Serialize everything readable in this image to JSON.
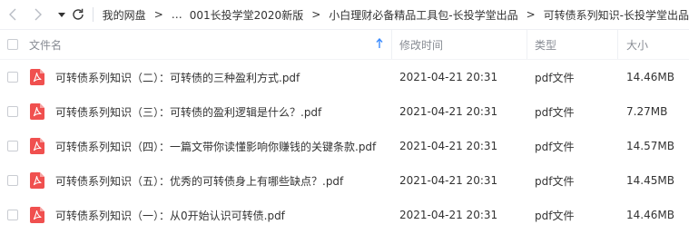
{
  "breadcrumb": {
    "ellipsis": "…",
    "separator": ">",
    "items": [
      "我的网盘",
      "001长投学堂2020新版",
      "小白理财必备精品工具包-长投学堂出品",
      "可转债系列知识-长投学堂出品"
    ]
  },
  "columns": {
    "name": "文件名",
    "modified": "修改时间",
    "type": "类型",
    "size": "大小"
  },
  "files": [
    {
      "name": "可转债系列知识（二）：可转债的三种盈利方式.pdf",
      "modified": "2021-04-21 20:31",
      "type": "pdf文件",
      "size": "14.46MB"
    },
    {
      "name": "可转债系列知识（三）：可转债的盈利逻辑是什么？.pdf",
      "modified": "2021-04-21 20:31",
      "type": "pdf文件",
      "size": "7.27MB"
    },
    {
      "name": "可转债系列知识（四）：一篇文带你读懂影响你赚钱的关键条款.pdf",
      "modified": "2021-04-21 20:31",
      "type": "pdf文件",
      "size": "14.57MB"
    },
    {
      "name": "可转债系列知识（五）：优秀的可转债身上有哪些缺点？.pdf",
      "modified": "2021-04-21 20:31",
      "type": "pdf文件",
      "size": "14.45MB"
    },
    {
      "name": "可转债系列知识（一）：从0开始认识可转债.pdf",
      "modified": "2021-04-21 20:31",
      "type": "pdf文件",
      "size": "14.46MB"
    }
  ],
  "icons": {
    "back": "chevron-left-icon",
    "forward": "chevron-right-icon",
    "history": "caret-down-icon",
    "refresh": "refresh-icon",
    "sort": "sort-ascending-icon",
    "file": "pdf-file-icon"
  },
  "colors": {
    "pdf_icon": "#f0504f",
    "sort_arrow": "#3b8cff",
    "header_text": "#888c94"
  }
}
